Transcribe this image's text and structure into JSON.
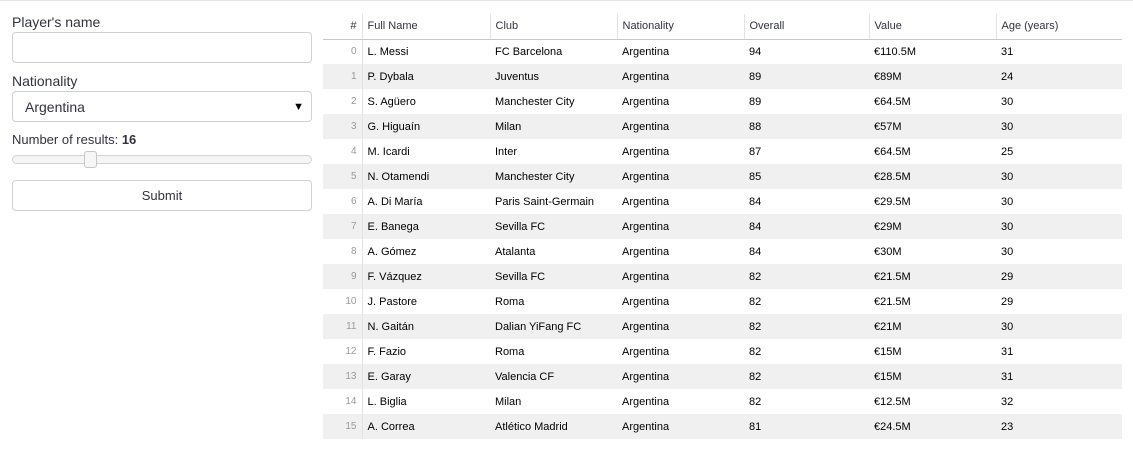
{
  "sidebar": {
    "name_label": "Player's name",
    "name_value": "",
    "nationality_label": "Nationality",
    "nationality_value": "Argentina",
    "results_label": "Number of results:",
    "results_value": "16",
    "slider_fraction": 0.25,
    "submit_label": "Submit"
  },
  "table": {
    "headers": [
      "#",
      "Full Name",
      "Club",
      "Nationality",
      "Overall",
      "Value",
      "Age (years)"
    ],
    "rows": [
      [
        "0",
        "L. Messi",
        "FC Barcelona",
        "Argentina",
        "94",
        "€110.5M",
        "31"
      ],
      [
        "1",
        "P. Dybala",
        "Juventus",
        "Argentina",
        "89",
        "€89M",
        "24"
      ],
      [
        "2",
        "S. Agüero",
        "Manchester City",
        "Argentina",
        "89",
        "€64.5M",
        "30"
      ],
      [
        "3",
        "G. Higuaín",
        "Milan",
        "Argentina",
        "88",
        "€57M",
        "30"
      ],
      [
        "4",
        "M. Icardi",
        "Inter",
        "Argentina",
        "87",
        "€64.5M",
        "25"
      ],
      [
        "5",
        "N. Otamendi",
        "Manchester City",
        "Argentina",
        "85",
        "€28.5M",
        "30"
      ],
      [
        "6",
        "A. Di María",
        "Paris Saint-Germain",
        "Argentina",
        "84",
        "€29.5M",
        "30"
      ],
      [
        "7",
        "E. Banega",
        "Sevilla FC",
        "Argentina",
        "84",
        "€29M",
        "30"
      ],
      [
        "8",
        "A. Gómez",
        "Atalanta",
        "Argentina",
        "84",
        "€30M",
        "30"
      ],
      [
        "9",
        "F. Vázquez",
        "Sevilla FC",
        "Argentina",
        "82",
        "€21.5M",
        "29"
      ],
      [
        "10",
        "J. Pastore",
        "Roma",
        "Argentina",
        "82",
        "€21.5M",
        "29"
      ],
      [
        "11",
        "N. Gaitán",
        "Dalian YiFang FC",
        "Argentina",
        "82",
        "€21M",
        "30"
      ],
      [
        "12",
        "F. Fazio",
        "Roma",
        "Argentina",
        "82",
        "€15M",
        "31"
      ],
      [
        "13",
        "E. Garay",
        "Valencia CF",
        "Argentina",
        "82",
        "€15M",
        "31"
      ],
      [
        "14",
        "L. Biglia",
        "Milan",
        "Argentina",
        "82",
        "€12.5M",
        "32"
      ],
      [
        "15",
        "A. Correa",
        "Atlético Madrid",
        "Argentina",
        "81",
        "€24.5M",
        "23"
      ]
    ]
  }
}
